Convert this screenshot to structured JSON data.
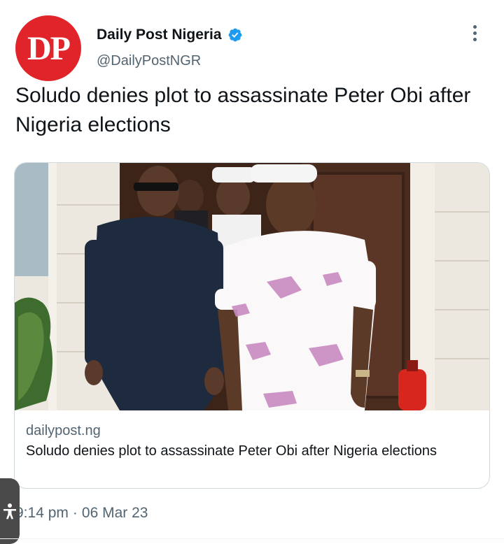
{
  "author": {
    "avatar_text": "DP",
    "display_name": "Daily Post Nigeria",
    "handle": "@DailyPostNGR",
    "verified_icon": "verified-badge-icon",
    "brand_color": "#e0242a"
  },
  "tweet": {
    "text": "Soludo denies plot to assassinate Peter Obi after Nigeria elections"
  },
  "card": {
    "domain": "dailypost.ng",
    "title": "Soludo denies plot to assassinate Peter Obi after Nigeria elections",
    "image_icon": "news-photo"
  },
  "meta": {
    "time": "9:14 pm",
    "separator": "·",
    "date": "06 Mar 23"
  }
}
